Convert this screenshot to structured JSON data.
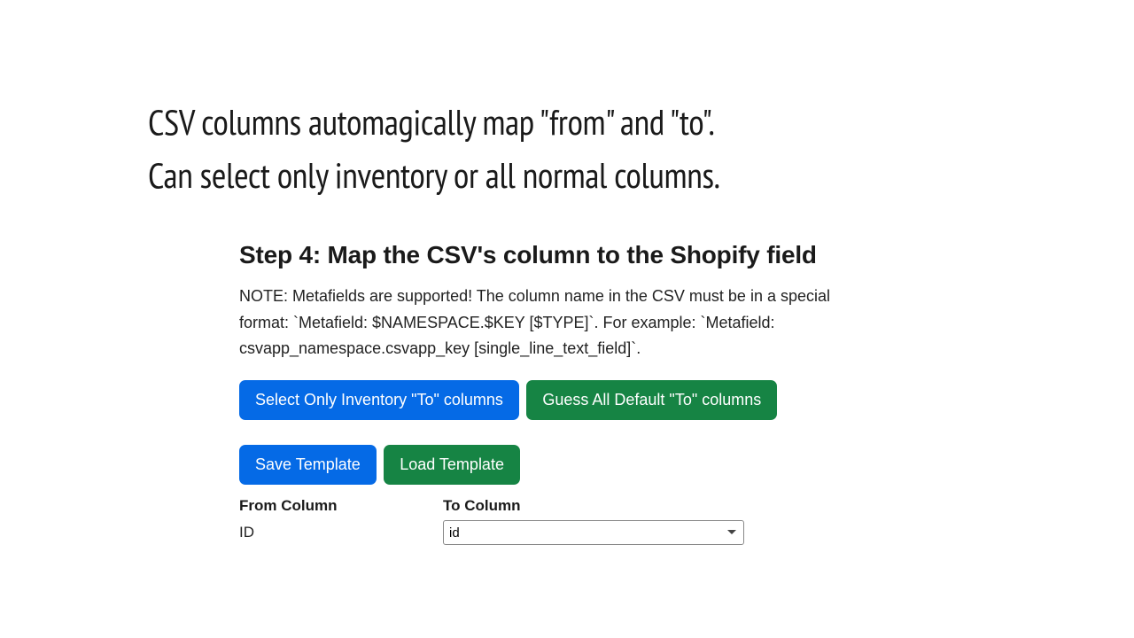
{
  "headline": {
    "line1": "CSV columns automagically map \"from\" and \"to\".",
    "line2": "Can select only inventory or all normal columns."
  },
  "panel": {
    "stepTitle": "Step 4: Map the CSV's column to the Shopify field",
    "note": "NOTE: Metafields are supported! The column name in the CSV must be in a special format: `Metafield: $NAMESPACE.$KEY [$TYPE]`. For example: `Metafield: csvapp_namespace.csvapp_key [single_line_text_field]`.",
    "buttons": {
      "selectInventory": "Select Only Inventory \"To\" columns",
      "guessDefault": "Guess All Default \"To\" columns",
      "saveTemplate": "Save Template",
      "loadTemplate": "Load Template"
    },
    "columns": {
      "fromHeader": "From Column",
      "toHeader": "To Column"
    },
    "mapping": {
      "fromValue": "ID",
      "toValue": "id"
    }
  }
}
